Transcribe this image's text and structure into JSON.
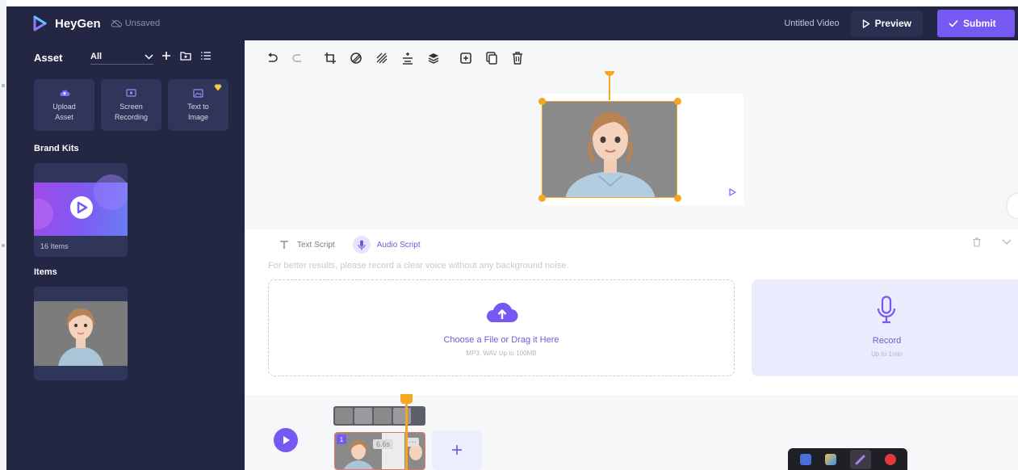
{
  "header": {
    "brand": "HeyGen",
    "save_status": "Unsaved",
    "doc_title": "Untitled Video",
    "preview_label": "Preview",
    "submit_label": "Submit"
  },
  "asset_panel": {
    "title": "Asset",
    "filter_value": "All",
    "tiles": [
      {
        "line1": "Upload",
        "line2": "Asset",
        "icon": "upload-cloud-icon"
      },
      {
        "line1": "Screen",
        "line2": "Recording",
        "icon": "screen-record-icon"
      },
      {
        "line1": "Text to",
        "line2": "Image",
        "icon": "image-icon",
        "badge": "premium-gem-icon"
      }
    ],
    "brand_kits_label": "Brand Kits",
    "brand_kit_count": "16 Items",
    "items_label": "Items"
  },
  "toolbar": {
    "icons": [
      "undo-icon",
      "redo-icon",
      "crop-icon",
      "mask-icon",
      "transparency-icon",
      "align-icon",
      "layers-icon",
      "duplicate-icon",
      "copy-icon",
      "delete-icon"
    ]
  },
  "script": {
    "tab_text": "Text Script",
    "tab_audio": "Audio Script",
    "hint": "For better results, please record a clear voice without any background noise.",
    "upload_title": "Choose a File or Drag it Here",
    "upload_sub": "MP3, WAV Up to 100MB",
    "record_title": "Record",
    "record_sub": "Up to 1min"
  },
  "timeline": {
    "clip_number": "1",
    "clip_duration": "6.6s",
    "clip_more": "···",
    "add_label": "+"
  },
  "colors": {
    "panel": "#232744",
    "accent": "#7559f2",
    "selection": "#f5a623"
  }
}
